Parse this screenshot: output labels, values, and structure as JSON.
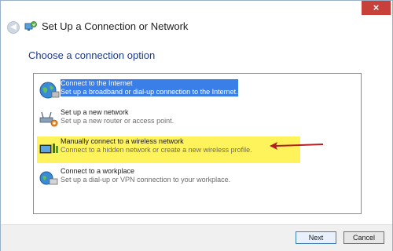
{
  "window": {
    "title": "Set Up a Connection or Network",
    "close_label": "×"
  },
  "page": {
    "subtitle": "Choose a connection option"
  },
  "options": [
    {
      "title": "Connect to the Internet",
      "desc": "Set up a broadband or dial-up connection to the Internet.",
      "icon": "globe-icon"
    },
    {
      "title": "Set up a new network",
      "desc": "Set up a new router or access point.",
      "icon": "router-icon"
    },
    {
      "title": "Manually connect to a wireless network",
      "desc": "Connect to a hidden network or create a new wireless profile.",
      "icon": "wireless-network-icon"
    },
    {
      "title": "Connect to a workplace",
      "desc": "Set up a dial-up or VPN connection to your workplace.",
      "icon": "workplace-icon"
    }
  ],
  "footer": {
    "next_label": "Next",
    "cancel_label": "Cancel"
  },
  "colors": {
    "selection": "#3a7ee8",
    "highlight": "#fff35b",
    "arrow": "#b51e22"
  }
}
